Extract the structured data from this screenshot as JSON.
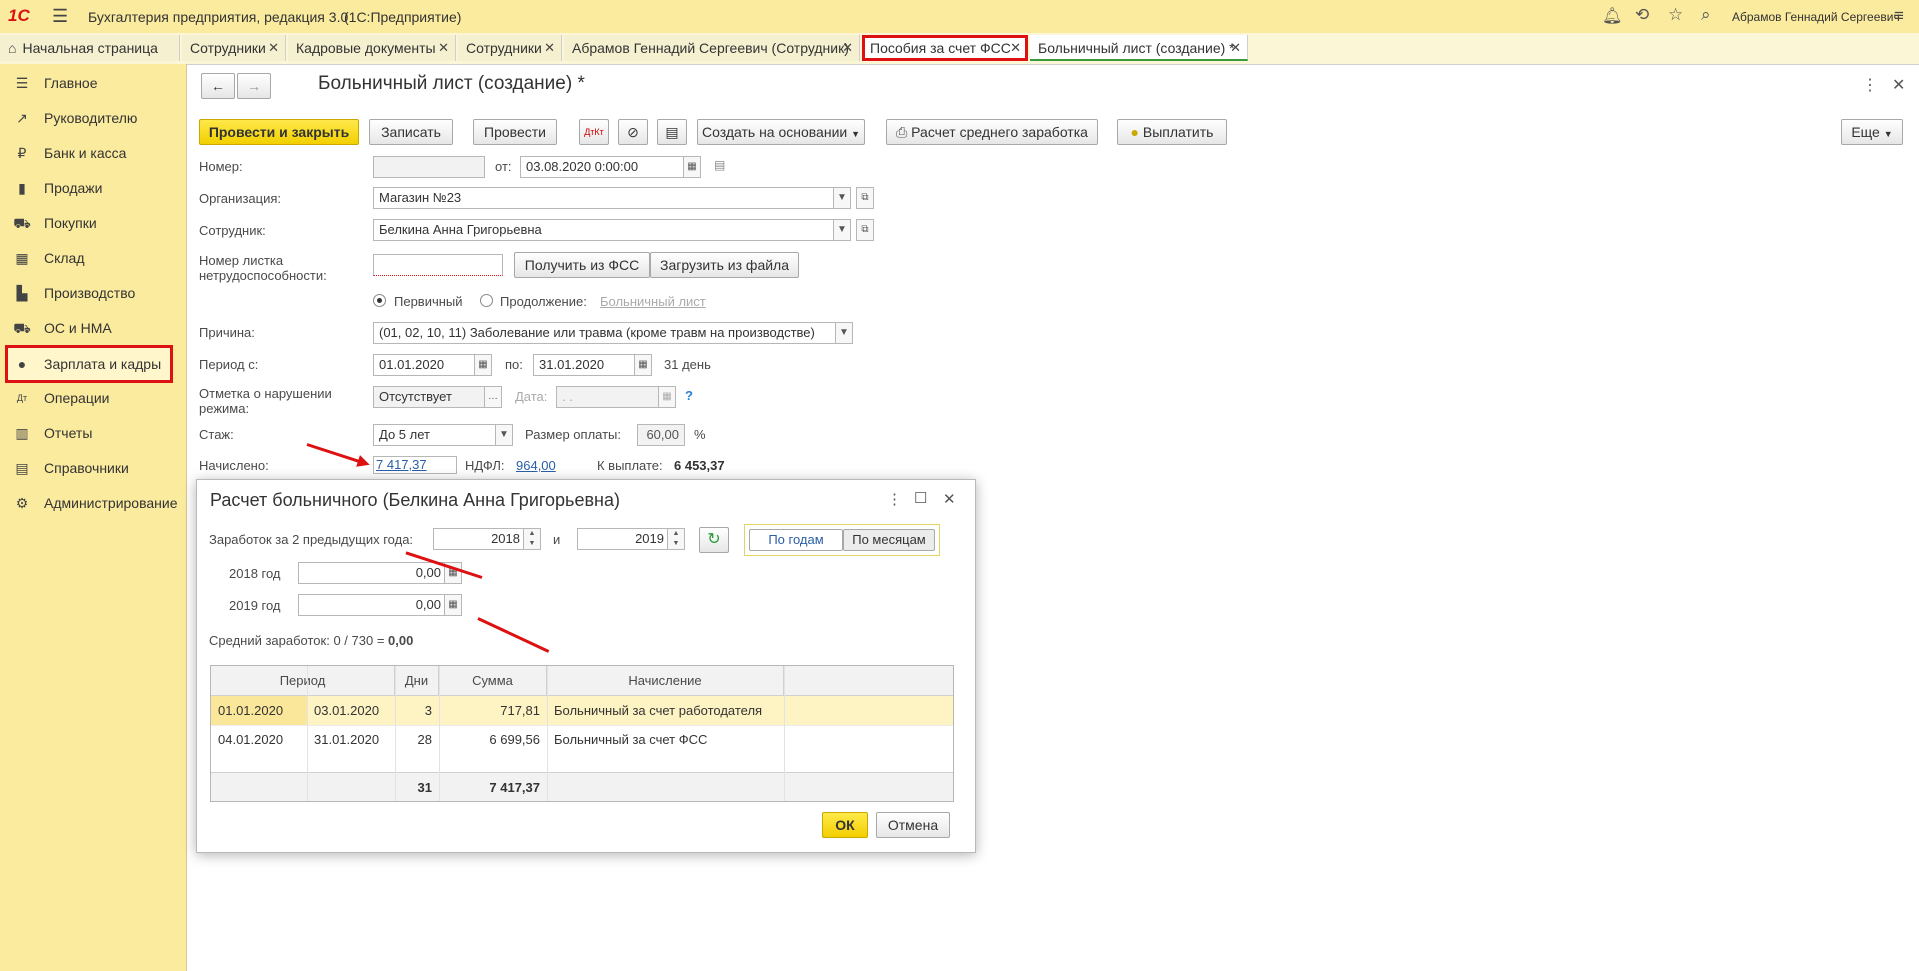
{
  "app": {
    "title": "Бухгалтерия предприятия, редакция 3.0",
    "subtitle": "(1С:Предприятие)",
    "logo": "1С",
    "user": "Абрамов Геннадий Сергеевич"
  },
  "tabs": [
    {
      "label": "Начальная страница"
    },
    {
      "label": "Сотрудники"
    },
    {
      "label": "Кадровые документы"
    },
    {
      "label": "Сотрудники"
    },
    {
      "label": "Абрамов Геннадий Сергеевич (Сотрудник)"
    },
    {
      "label": "Пособия за счет ФСС"
    },
    {
      "label": "Больничный лист (создание) *"
    }
  ],
  "sidebar": {
    "items": [
      {
        "label": "Главное",
        "icon": "menu-icon"
      },
      {
        "label": "Руководителю",
        "icon": "trend-icon"
      },
      {
        "label": "Банк и касса",
        "icon": "ruble-icon"
      },
      {
        "label": "Продажи",
        "icon": "bag-icon"
      },
      {
        "label": "Покупки",
        "icon": "cart-icon"
      },
      {
        "label": "Склад",
        "icon": "warehouse-icon"
      },
      {
        "label": "Производство",
        "icon": "factory-icon"
      },
      {
        "label": "ОС и НМА",
        "icon": "truck-icon"
      },
      {
        "label": "Зарплата и кадры",
        "icon": "person-icon"
      },
      {
        "label": "Операции",
        "icon": "dt-kt-icon"
      },
      {
        "label": "Отчеты",
        "icon": "chart-icon"
      },
      {
        "label": "Справочники",
        "icon": "book-icon"
      },
      {
        "label": "Администрирование",
        "icon": "gear-icon"
      }
    ]
  },
  "form": {
    "title": "Больничный лист (создание) *",
    "toolbar": {
      "post_close": "Провести и закрыть",
      "save": "Записать",
      "post": "Провести",
      "create_based": "Создать на основании",
      "calc_avg": "Расчет среднего заработка",
      "pay": "Выплатить",
      "more": "Еще"
    },
    "number_label": "Номер:",
    "number_value": "",
    "from_label": "от:",
    "date_value": "03.08.2020  0:00:00",
    "org_label": "Организация:",
    "org_value": "Магазин №23",
    "employee_label": "Сотрудник:",
    "employee_value": "Белкина Анна Григорьевна",
    "sheet_label": "Номер листка нетрудоспособности:",
    "sheet_value": "",
    "get_fss": "Получить из ФСС",
    "load_file": "Загрузить из файла",
    "primary": "Первичный",
    "continuation": "Продолжение:",
    "sick_link": "Больничный лист",
    "reason_label": "Причина:",
    "reason_value": "(01, 02, 10, 11) Заболевание или травма (кроме травм на производстве)",
    "period_label": "Период с:",
    "period_from": "01.01.2020",
    "period_to_label": "по:",
    "period_to": "31.01.2020",
    "period_days": "31 день",
    "violation_label": "Отметка о нарушении режима:",
    "violation_value": "Отсутствует",
    "violation_date_label": "Дата:",
    "violation_date_value": " .  .",
    "help": "?",
    "stazh_label": "Стаж:",
    "stazh_value": "До 5 лет",
    "pay_size_label": "Размер оплаты:",
    "pay_size_value": "60,00",
    "pay_size_unit": "%",
    "accrued_label": "Начислено:",
    "accrued_value": "7 417,37",
    "ndfl_label": "НДФЛ:",
    "ndfl_value": "964,00",
    "to_pay_label": "К выплате:",
    "to_pay_value": "6 453,37"
  },
  "dialog": {
    "title": "Расчет больничного (Белкина Анна Григорьевна)",
    "earnings_label": "Заработок за 2 предыдущих года:",
    "year1": "2018",
    "and": "и",
    "year2": "2019",
    "by_years": "По годам",
    "by_months": "По месяцам",
    "year1_label": "2018 год",
    "year1_value": "0,00",
    "year2_label": "2019 год",
    "year2_value": "0,00",
    "avg_label": "Средний заработок: 0 / 730 =",
    "avg_value": "0,00",
    "table": {
      "headers": {
        "period": "Период",
        "days": "Дни",
        "sum": "Сумма",
        "accrual": "Начисление"
      },
      "rows": [
        {
          "from": "01.01.2020",
          "to": "03.01.2020",
          "days": "3",
          "sum": "717,81",
          "accrual": "Больничный за счет работодателя"
        },
        {
          "from": "04.01.2020",
          "to": "31.01.2020",
          "days": "28",
          "sum": "6 699,56",
          "accrual": "Больничный за счет ФСС"
        }
      ],
      "total_days": "31",
      "total_sum": "7 417,37"
    },
    "ok": "ОК",
    "cancel": "Отмена"
  },
  "colors": {
    "accent_yellow": "#f2cf00",
    "highlight_red": "#dd1111",
    "sidebar_bg": "#fbeb9f",
    "selected_row": "#fdf3c3"
  }
}
